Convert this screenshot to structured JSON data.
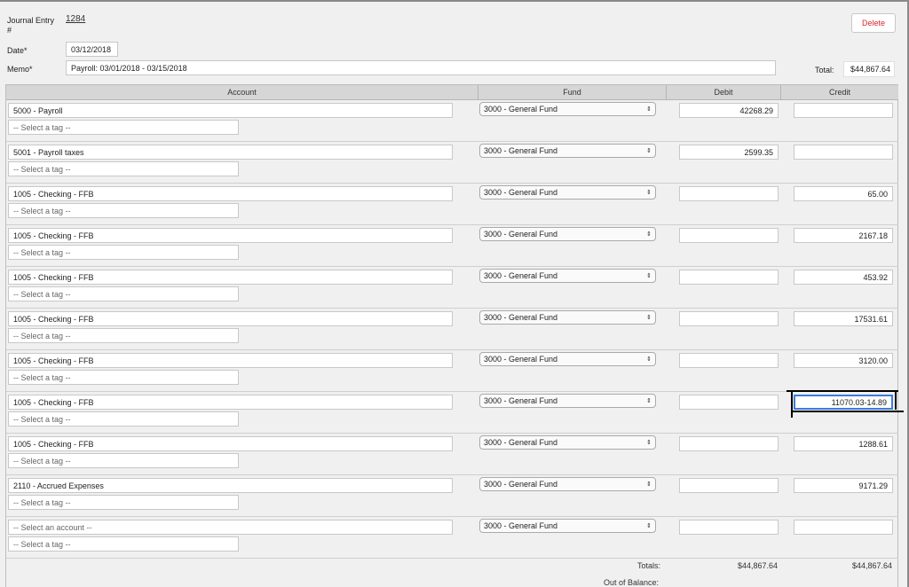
{
  "header": {
    "entry_label": "Journal Entry\n#",
    "entry_number": "1284",
    "delete_label": "Delete",
    "date_label": "Date*",
    "date_value": "03/12/2018",
    "memo_label": "Memo*",
    "memo_value": "Payroll: 03/01/2018 - 03/15/2018",
    "total_label": "Total:",
    "total_value": "$44,867.64"
  },
  "table": {
    "columns": [
      "Account",
      "Fund",
      "Debit",
      "Credit"
    ],
    "tag_placeholder": "-- Select a tag --",
    "rows": [
      {
        "account": "5000 - Payroll",
        "fund": "3000 - General Fund",
        "debit": "42268.29",
        "credit": ""
      },
      {
        "account": "5001 - Payroll taxes",
        "fund": "3000 - General Fund",
        "debit": "2599.35",
        "credit": ""
      },
      {
        "account": "1005 - Checking - FFB",
        "fund": "3000 - General Fund",
        "debit": "",
        "credit": "65.00"
      },
      {
        "account": "1005 - Checking - FFB",
        "fund": "3000 - General Fund",
        "debit": "",
        "credit": "2167.18"
      },
      {
        "account": "1005 - Checking - FFB",
        "fund": "3000 - General Fund",
        "debit": "",
        "credit": "453.92"
      },
      {
        "account": "1005 - Checking - FFB",
        "fund": "3000 - General Fund",
        "debit": "",
        "credit": "17531.61"
      },
      {
        "account": "1005 - Checking - FFB",
        "fund": "3000 - General Fund",
        "debit": "",
        "credit": "3120.00"
      },
      {
        "account": "1005 - Checking - FFB",
        "fund": "3000 - General Fund",
        "debit": "",
        "credit": "11070.03-14.89"
      },
      {
        "account": "1005 - Checking - FFB",
        "fund": "3000 - General Fund",
        "debit": "",
        "credit": "1288.61"
      },
      {
        "account": "2110 - Accrued Expenses",
        "fund": "3000 - General Fund",
        "debit": "",
        "credit": "9171.29"
      },
      {
        "account": "-- Select an account --",
        "fund": "3000 - General Fund",
        "debit": "",
        "credit": ""
      }
    ]
  },
  "footer": {
    "totals_label": "Totals:",
    "debit_total": "$44,867.64",
    "credit_total": "$44,867.64",
    "out_of_balance_label": "Out of Balance:"
  },
  "icons": {
    "select_arrow": "up-down-chevron-icon"
  }
}
